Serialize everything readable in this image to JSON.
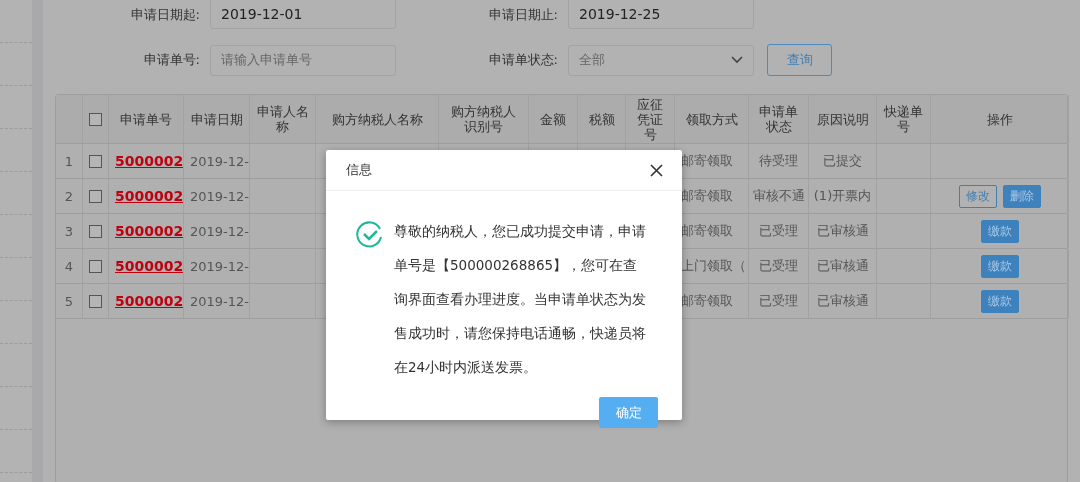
{
  "filters": [
    {
      "label": "申请日期起:",
      "kind": "input",
      "value": "2019-12-01"
    },
    {
      "label": "申请日期止:",
      "kind": "input",
      "value": "2019-12-25"
    },
    {
      "label": "申请单号:",
      "kind": "input",
      "placeholder": "请输入申请单号"
    },
    {
      "label": "申请单状态:",
      "kind": "select",
      "placeholder": "全部"
    }
  ],
  "query_button": "查询",
  "table": {
    "select_all_checked": false,
    "columns": [
      "申请单号",
      "申请日期",
      "申请人名称",
      "购方纳税人名称",
      "购方纳税人识别号",
      "金额",
      "税额",
      "应征凭证号",
      "领取方式",
      "申请单状态",
      "原因说明",
      "快递单号",
      "操作"
    ],
    "rows": [
      {
        "index": "1",
        "checked": false,
        "order_no": "5000002",
        "date": "2019-12-",
        "pickup": "邮寄领取",
        "status": "待受理",
        "reason": "已提交",
        "actions": []
      },
      {
        "index": "2",
        "checked": false,
        "order_no": "5000002",
        "date": "2019-12-",
        "pickup": "邮寄领取",
        "status": "审核不通",
        "reason": "(1)开票内",
        "actions": [
          {
            "label": "修改",
            "kind": "outline"
          },
          {
            "label": "删除",
            "kind": "filled"
          }
        ]
      },
      {
        "index": "3",
        "checked": false,
        "order_no": "5000002",
        "date": "2019-12-",
        "pickup": "邮寄领取",
        "status": "已受理",
        "reason": "已审核通",
        "actions": [
          {
            "label": "缴款",
            "kind": "filled"
          }
        ]
      },
      {
        "index": "4",
        "checked": false,
        "order_no": "5000002",
        "date": "2019-12-",
        "pickup": "上门领取（",
        "status": "已受理",
        "reason": "已审核通",
        "actions": [
          {
            "label": "缴款",
            "kind": "filled"
          }
        ]
      },
      {
        "index": "5",
        "checked": false,
        "order_no": "5000002",
        "date": "2019-12-",
        "pickup": "邮寄领取",
        "status": "已受理",
        "reason": "已审核通",
        "actions": [
          {
            "label": "缴款",
            "kind": "filled"
          }
        ]
      }
    ]
  },
  "dialog": {
    "title": "信息",
    "message": "尊敬的纳税人，您已成功提交申请，申请单号是【500000268865】，您可在查询界面查看办理进度。当申请单状态为发售成功时，请您保持电话通畅，快递员将在24小时内派送发票。",
    "button": "确定"
  }
}
